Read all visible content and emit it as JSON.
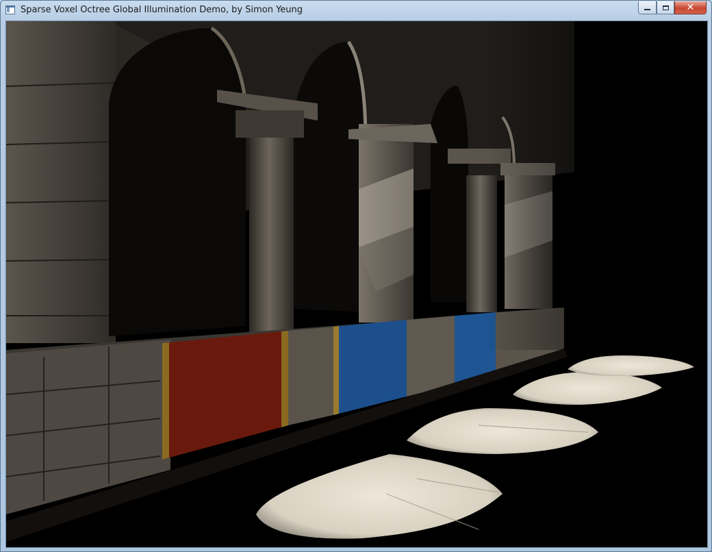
{
  "window": {
    "title": "Sparse Voxel Octree Global Illumination Demo, by Simon Yeung",
    "controls": {
      "minimize_icon": "minimize-icon",
      "maximize_icon": "maximize-icon",
      "close_icon": "close-icon",
      "close_glyph": "✕"
    },
    "app_icon": "window-app-icon"
  },
  "scene": {
    "description_icon": "3d-render-viewport",
    "colors": {
      "background": "#000000",
      "stone": "#4a4540",
      "stone_lit": "#9a948b",
      "banner_red": "#6a1a0c",
      "banner_blue": "#1c4f8c",
      "floor_light": "#e6e0d2"
    }
  }
}
